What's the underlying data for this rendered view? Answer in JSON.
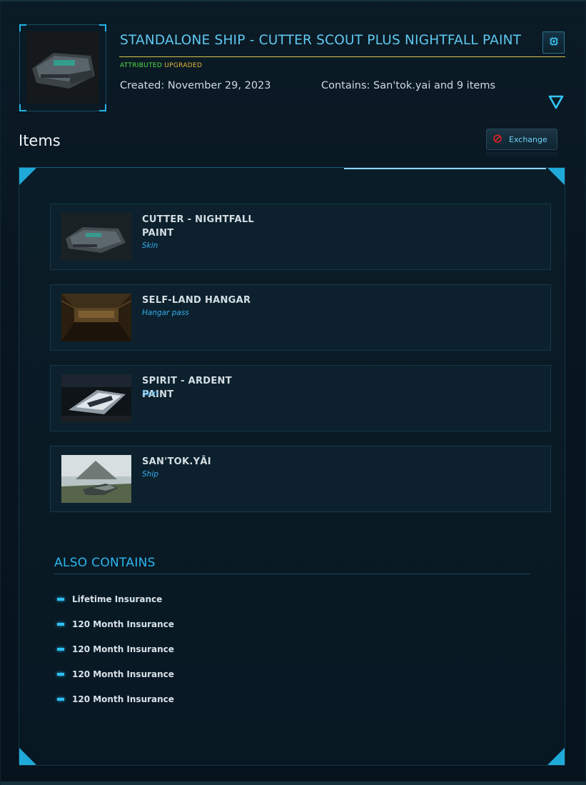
{
  "header": {
    "title": "STANDALONE SHIP - CUTTER SCOUT PLUS NIGHTFALL PAINT",
    "status_attributed": "ATTRIBUTED",
    "status_upgraded": "UPGRADED",
    "created": "Created: November 29, 2023",
    "contains": "Contains: San'tok.yai and 9 items",
    "chip_icon": "chip-icon",
    "toggle_icon": "triangle-down-icon"
  },
  "items_section": {
    "heading": "Items",
    "exchange_label": "Exchange"
  },
  "items": [
    {
      "name": "CUTTER - NIGHTFALL PAINT",
      "type": "Skin"
    },
    {
      "name": "SELF-LAND HANGAR",
      "type": "Hangar pass"
    },
    {
      "name": "SPIRIT - ARDENT PAINT",
      "type": "Skin"
    },
    {
      "name": "SAN'TOK.YĀI",
      "type": "Ship"
    }
  ],
  "also_contains": {
    "heading": "ALSO CONTAINS",
    "entries": [
      "Lifetime Insurance",
      "120 Month Insurance",
      "120 Month Insurance",
      "120 Month Insurance",
      "120 Month Insurance"
    ]
  },
  "colors": {
    "accent": "#1fa9d9",
    "title": "#5ec8f0",
    "attributed": "#55e04a",
    "upgraded": "#e8b83a",
    "item_type": "#36aef0"
  }
}
